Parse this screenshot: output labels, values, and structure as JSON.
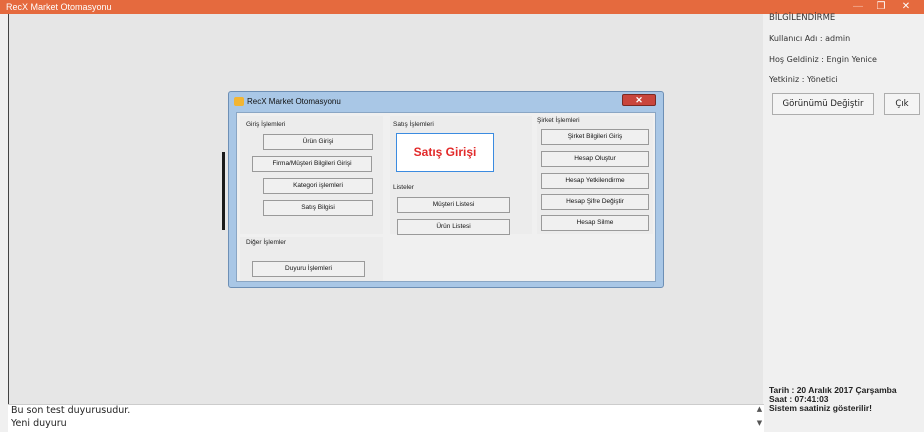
{
  "app": {
    "title": "RecX Market Otomasyonu",
    "controls": {
      "minimize": "—",
      "maximize": "❐",
      "close": "✕"
    }
  },
  "right_panel": {
    "heading": "BİLGİLENDİRME",
    "user": "Kullanıcı Adı : admin",
    "welcome": "Hoş Geldiniz : Engin Yenice",
    "role": "Yetkiniz : Yönetici",
    "change_view_label": "Görünümü Değiştir",
    "exit_label": "Çık",
    "date": "Tarih : 20 Aralık 2017 Çarşamba",
    "time": "Saat  : 07:41:03",
    "clock_note": "Sistem saatiniz gösterilir!"
  },
  "announcements": {
    "lines": [
      "Bu son test duyurusudur.",
      "Yeni duyuru"
    ]
  },
  "dialog": {
    "title": "RecX Market Otomasyonu",
    "close_label": "✕",
    "giris": {
      "label": "Giriş İşlemleri",
      "buttons": [
        "Ürün Girişi",
        "Firma/Müşteri Bilgileri Girişi",
        "Kategori işlemleri",
        "Satış Bilgisi"
      ]
    },
    "satis": {
      "label": "Satış İşlemleri",
      "main_button": "Satış Girişi"
    },
    "listeler": {
      "label": "Listeler",
      "buttons": [
        "Müşteri Listesi",
        "Ürün Listesi"
      ]
    },
    "sirket": {
      "label": "Şirket İşlemleri",
      "buttons": [
        "Şirket Bilgileri Giriş",
        "Hesap Oluştur",
        "Hesap Yetkilendirme",
        "Hesap Şifre Değiştir",
        "Hesap Silme"
      ]
    },
    "diger": {
      "label": "Diğer İşlemler",
      "buttons": [
        "Duyuru İşlemleri"
      ]
    }
  },
  "colors": {
    "titlebar": "#e56a3e",
    "dialog_frame": "#a9c7e6",
    "accent_red": "#e22a2a",
    "focus_blue": "#3b8be0"
  }
}
